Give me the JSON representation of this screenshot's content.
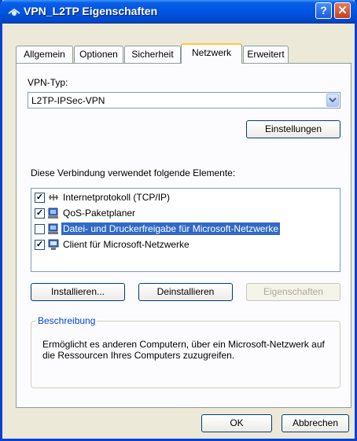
{
  "window": {
    "title": "VPN_L2TP Eigenschaften",
    "help_label": "?",
    "close_label": "✕"
  },
  "tabs": [
    {
      "label": "Allgemein"
    },
    {
      "label": "Optionen"
    },
    {
      "label": "Sicherheit"
    },
    {
      "label": "Netzwerk"
    },
    {
      "label": "Erweitert"
    }
  ],
  "active_tab": "Netzwerk",
  "vpn_type": {
    "label": "VPN-Typ:",
    "value": "L2TP-IPSec-VPN"
  },
  "buttons": {
    "settings": "Einstellungen",
    "install": "Installieren...",
    "uninstall": "Deinstallieren",
    "properties": "Eigenschaften",
    "ok": "OK",
    "cancel": "Abbrechen"
  },
  "components": {
    "label": "Diese Verbindung verwendet folgende Elemente:",
    "items": [
      {
        "label": "Internetprotokoll (TCP/IP)",
        "checked": true,
        "icon": "network-protocol-icon"
      },
      {
        "label": "QoS-Paketplaner",
        "checked": true,
        "icon": "network-service-icon"
      },
      {
        "label": "Datei- und Druckerfreigabe für Microsoft-Netzwerke",
        "checked": false,
        "icon": "network-service-icon"
      },
      {
        "label": "Client für Microsoft-Netzwerke",
        "checked": true,
        "icon": "network-client-icon"
      }
    ],
    "selected_index": 2
  },
  "description": {
    "title": "Beschreibung",
    "text": "Ermöglicht es anderen Computern, über ein Microsoft-Netzwerk auf die Ressourcen Ihres Computers zuzugreifen."
  },
  "colors": {
    "titlebar": "#0054e3",
    "selection": "#316ac5",
    "dialog_bg": "#ece9d8",
    "active_tab_accent": "#ffc73c"
  }
}
